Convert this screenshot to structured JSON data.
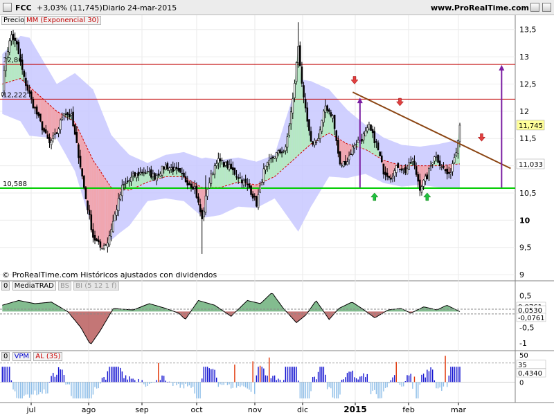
{
  "header": {
    "ticker": "FCC",
    "change": "+3,03% (11,745)",
    "period": "Diario",
    "date": "24-mar-2015",
    "site": "www.ProRealTime.com"
  },
  "legend": {
    "price_label": "Precio",
    "ma_label": "MM (Exponencial 30)",
    "copyright": "© ProRealTime.com Históricos ajustados con dividendos"
  },
  "panel2": {
    "tag0": "0",
    "name": "MediaTRAD",
    "tag1": "BS",
    "tag2": "BI (5 12 1 f)"
  },
  "panel3": {
    "tag0": "0",
    "name": "VPM",
    "tag1": "AL (35)"
  },
  "chart_data": [
    {
      "type": "candlestick",
      "ylim": [
        8.9,
        13.75
      ],
      "yticks": [
        "13,5",
        "13",
        "12,5",
        "12",
        "11,5",
        "11",
        "10,5",
        "10",
        "9,5",
        "9"
      ],
      "ytick_values": [
        13.5,
        13,
        12.5,
        12,
        11.5,
        11,
        10.5,
        10,
        9.5,
        9
      ],
      "xlabels": [
        "jul",
        "ago",
        "sep",
        "oct",
        "nov",
        "dic",
        "2015",
        "feb",
        "mar"
      ],
      "price_waypoints": [
        [
          0,
          12.4
        ],
        [
          2,
          13.0
        ],
        [
          5,
          13.4
        ],
        [
          8,
          13.2
        ],
        [
          12,
          12.6
        ],
        [
          16,
          12.2
        ],
        [
          22,
          11.7
        ],
        [
          26,
          11.4
        ],
        [
          30,
          11.6
        ],
        [
          34,
          12.0
        ],
        [
          38,
          11.9
        ],
        [
          42,
          11.2
        ],
        [
          46,
          10.4
        ],
        [
          50,
          9.7
        ],
        [
          54,
          9.5
        ],
        [
          58,
          9.6
        ],
        [
          62,
          10.1
        ],
        [
          66,
          10.6
        ],
        [
          72,
          10.8
        ],
        [
          78,
          10.9
        ],
        [
          84,
          10.8
        ],
        [
          90,
          11.0
        ],
        [
          96,
          10.9
        ],
        [
          102,
          10.7
        ],
        [
          106,
          10.6
        ],
        [
          110,
          10.0
        ],
        [
          113,
          10.6
        ],
        [
          118,
          11.1
        ],
        [
          124,
          11.0
        ],
        [
          130,
          10.8
        ],
        [
          136,
          10.6
        ],
        [
          140,
          10.3
        ],
        [
          144,
          10.9
        ],
        [
          150,
          11.2
        ],
        [
          156,
          11.3
        ],
        [
          160,
          12.2
        ],
        [
          163,
          13.2
        ],
        [
          166,
          12.2
        ],
        [
          170,
          11.4
        ],
        [
          174,
          11.5
        ],
        [
          178,
          12.1
        ],
        [
          182,
          11.9
        ],
        [
          186,
          11.0
        ],
        [
          190,
          11.1
        ],
        [
          194,
          11.4
        ],
        [
          198,
          11.5
        ],
        [
          202,
          11.7
        ],
        [
          206,
          11.4
        ],
        [
          210,
          10.9
        ],
        [
          214,
          10.8
        ],
        [
          218,
          11.0
        ],
        [
          222,
          10.9
        ],
        [
          226,
          11.1
        ],
        [
          230,
          10.6
        ],
        [
          234,
          10.8
        ],
        [
          238,
          11.2
        ],
        [
          242,
          11.0
        ],
        [
          246,
          10.8
        ],
        [
          250,
          11.3
        ],
        [
          252,
          11.745
        ]
      ],
      "ema30_waypoints": [
        [
          0,
          12.5
        ],
        [
          10,
          12.6
        ],
        [
          20,
          12.3
        ],
        [
          30,
          12.0
        ],
        [
          40,
          11.8
        ],
        [
          50,
          11.1
        ],
        [
          60,
          10.6
        ],
        [
          70,
          10.55
        ],
        [
          80,
          10.7
        ],
        [
          90,
          10.8
        ],
        [
          100,
          10.8
        ],
        [
          110,
          10.6
        ],
        [
          120,
          10.6
        ],
        [
          130,
          10.7
        ],
        [
          140,
          10.65
        ],
        [
          150,
          10.8
        ],
        [
          160,
          11.1
        ],
        [
          170,
          11.4
        ],
        [
          180,
          11.6
        ],
        [
          190,
          11.4
        ],
        [
          200,
          11.3
        ],
        [
          210,
          11.1
        ],
        [
          220,
          11.0
        ],
        [
          230,
          11.0
        ],
        [
          240,
          11.0
        ],
        [
          252,
          11.033
        ]
      ],
      "band_width_waypoints": [
        [
          0,
          0.55
        ],
        [
          15,
          0.9
        ],
        [
          30,
          0.5
        ],
        [
          50,
          1.3
        ],
        [
          65,
          0.8
        ],
        [
          80,
          0.35
        ],
        [
          100,
          0.45
        ],
        [
          112,
          0.55
        ],
        [
          130,
          0.45
        ],
        [
          150,
          0.4
        ],
        [
          163,
          1.4
        ],
        [
          180,
          0.8
        ],
        [
          200,
          0.45
        ],
        [
          230,
          0.35
        ],
        [
          252,
          0.45
        ]
      ],
      "horizontal_lines": [
        {
          "value": 12.86,
          "label": "12,86",
          "color": "#c00000"
        },
        {
          "value": 12.222,
          "label": "12,222",
          "color": "#c00000"
        },
        {
          "value": 10.588,
          "label": "10,588",
          "color": "#00cc00"
        }
      ],
      "trendline": {
        "from": [
          193,
          12.35
        ],
        "to": [
          280,
          10.95
        ],
        "color": "#8b4513"
      },
      "purple_arrows": [
        [
          197,
          10.6,
          12.25
        ],
        [
          275,
          10.6,
          12.85
        ]
      ],
      "red_down_arrows": [
        [
          194,
          12.55
        ],
        [
          219,
          12.15
        ],
        [
          264,
          11.5
        ]
      ],
      "green_up_arrows": [
        [
          205,
          10.45
        ],
        [
          234,
          10.45
        ]
      ],
      "price_tags": [
        {
          "label": "11,745",
          "value": 11.745,
          "bg": "#ffff99"
        },
        {
          "label": "11,033",
          "value": 11.033,
          "bg": "#ffffff"
        }
      ],
      "colors": {
        "band": "#c8c8ff",
        "ema": "#d00000",
        "up_fill": "#b6e8c4",
        "down_fill": "#f0a6b0",
        "candle": "#000000"
      }
    },
    {
      "type": "area",
      "title": "MediaTRAD",
      "ylim": [
        -1.15,
        0.95
      ],
      "yticks": [
        "0,5",
        "0",
        "-0,5",
        "-1"
      ],
      "ytick_values": [
        0.5,
        0,
        -0.5,
        -1
      ],
      "series_waypoints": [
        [
          0,
          0.2
        ],
        [
          10,
          0.35
        ],
        [
          20,
          0.25
        ],
        [
          30,
          0.3
        ],
        [
          40,
          0.0
        ],
        [
          48,
          -0.5
        ],
        [
          54,
          -1.05
        ],
        [
          60,
          -0.6
        ],
        [
          68,
          0.1
        ],
        [
          80,
          0.05
        ],
        [
          90,
          0.25
        ],
        [
          100,
          0.1
        ],
        [
          108,
          -0.05
        ],
        [
          112,
          -0.25
        ],
        [
          120,
          0.35
        ],
        [
          130,
          0.2
        ],
        [
          140,
          -0.15
        ],
        [
          150,
          0.35
        ],
        [
          158,
          0.25
        ],
        [
          165,
          0.6
        ],
        [
          172,
          0.1
        ],
        [
          180,
          -0.35
        ],
        [
          186,
          -0.1
        ],
        [
          192,
          0.35
        ],
        [
          200,
          -0.25
        ],
        [
          206,
          0.1
        ],
        [
          214,
          0.3
        ],
        [
          220,
          0.1
        ],
        [
          228,
          -0.2
        ],
        [
          236,
          0.05
        ],
        [
          244,
          0.1
        ],
        [
          250,
          -0.05
        ],
        [
          258,
          0.15
        ],
        [
          266,
          0.05
        ],
        [
          272,
          0.2
        ],
        [
          280,
          0.0
        ]
      ],
      "band_value": 0.0761,
      "tags": [
        {
          "label": "0,0761",
          "value": 0.0761
        },
        {
          "label": "0,0530",
          "value": 0.053
        },
        {
          "label": "-0,0761",
          "value": -0.0761
        }
      ]
    },
    {
      "type": "bar",
      "title": "VPM",
      "ylim": [
        -35,
        55
      ],
      "yticks": [
        "50",
        "0"
      ],
      "ytick_values": [
        50,
        0
      ],
      "al_level": 35,
      "red_bars": [
        [
          86,
          35
        ],
        [
          128,
          32
        ],
        [
          138,
          38
        ],
        [
          142,
          30
        ],
        [
          147,
          45
        ],
        [
          217,
          37
        ],
        [
          227,
          10
        ],
        [
          244,
          48
        ]
      ],
      "tags": [
        {
          "label": "35",
          "value": 35
        },
        {
          "label": "0,4340",
          "value": 0.434
        }
      ]
    }
  ]
}
